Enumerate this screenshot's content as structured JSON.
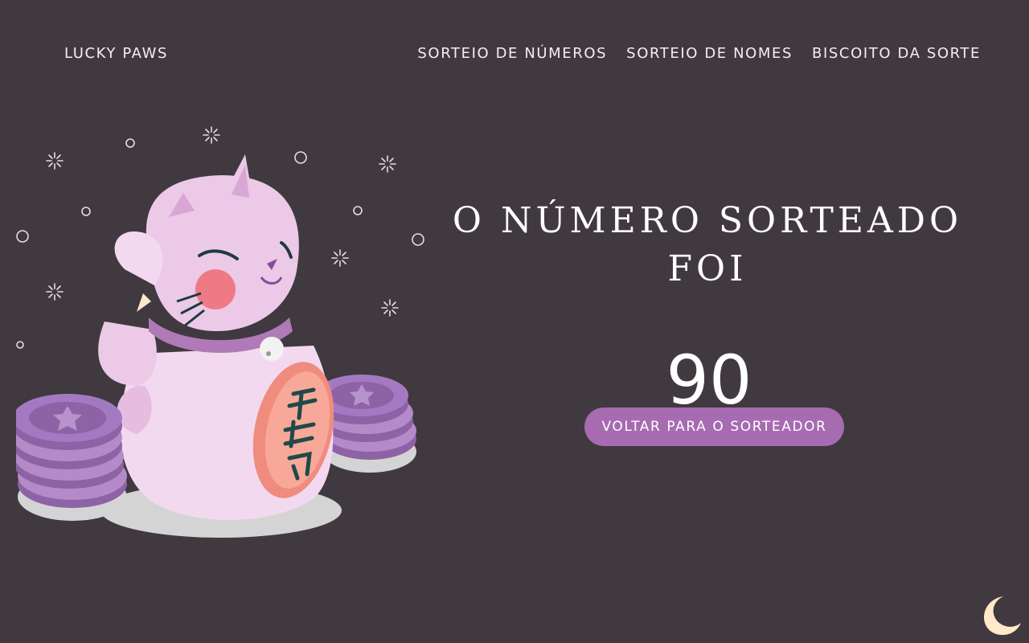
{
  "header": {
    "brand": "LUCKY PAWS",
    "nav": [
      {
        "label": "SORTEIO DE NÚMEROS"
      },
      {
        "label": "SORTEIO DE NOMES"
      },
      {
        "label": "BISCOITO DA SORTE"
      }
    ]
  },
  "result": {
    "title": "O NÚMERO SORTEADO FOI",
    "number": "90",
    "back_button": "VOLTAR PARA O SORTEADOR"
  },
  "colors": {
    "background": "#413940",
    "accent": "#a76bb2",
    "cat": "#ecc9e7",
    "coin": "#a37ac2",
    "moon": "#ffe9c8"
  },
  "icons": {
    "illustration": "lucky-cat-illustration",
    "theme_toggle": "moon-icon"
  }
}
